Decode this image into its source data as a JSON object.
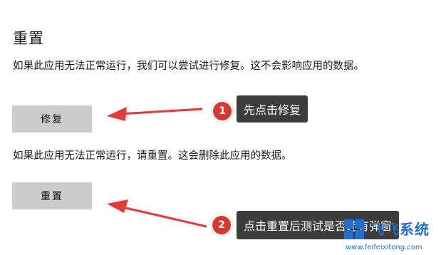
{
  "reset": {
    "title": "重置",
    "repair_desc": "如果此应用无法正常运行，我们可以尝试进行修复。这不会影响应用的数据。",
    "repair_button": "修复",
    "reset_desc": "如果此应用无法正常运行，请重置。这会删除此应用的数据。",
    "reset_button": "重置"
  },
  "annotations": {
    "step1_number": "1",
    "step1_text": "先点击修复",
    "step2_number": "2",
    "step2_text": "点击重置后测试是否还有弹窗"
  },
  "watermark": {
    "brand": "飞飞系统",
    "url": "www.feifeixitong.com"
  },
  "colors": {
    "arrow": "#e53935",
    "badge": "#d43a2f",
    "callout_bg": "#3c3c3c",
    "button_bg": "#cccccc",
    "watermark": "#1f6fd1"
  }
}
